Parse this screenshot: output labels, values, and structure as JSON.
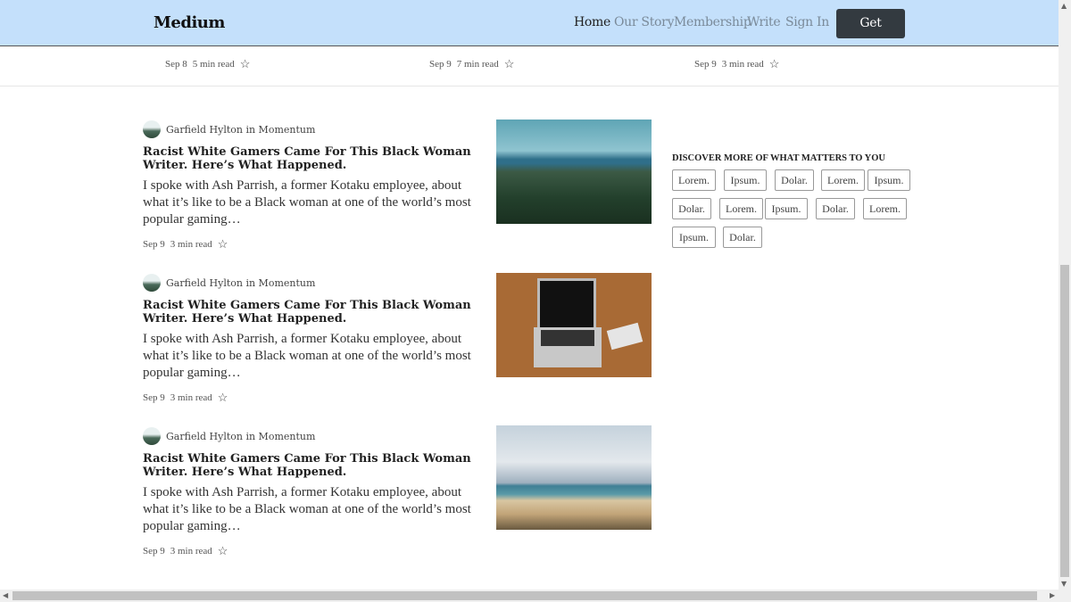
{
  "nav": {
    "logo": "Medium",
    "links": [
      "Home",
      "Our Story",
      "Membership",
      "Write",
      "Sign In"
    ],
    "cta": "Get Started"
  },
  "trending": [
    {
      "date": "Sep 8",
      "read": "5 min read"
    },
    {
      "date": "Sep 9",
      "read": "7 min read"
    },
    {
      "date": "Sep 9",
      "read": "3 min read"
    }
  ],
  "articles": [
    {
      "author": "Garfield Hylton in Momentum",
      "title": "Racist White Gamers Came For This Black Woman Writer. Here’s What Happened.",
      "excerpt": "I spoke with Ash Parrish, a former Kotaku employee, about what it’s like to be a Black woman at one of the world’s most popular gaming…",
      "date": "Sep 9",
      "read": "3 min read",
      "image": "forest"
    },
    {
      "author": "Garfield Hylton in Momentum",
      "title": "Racist White Gamers Came For This Black Woman Writer. Here’s What Happened.",
      "excerpt": "I spoke with Ash Parrish, a former Kotaku employee, about what it’s like to be a Black woman at one of the world’s most popular gaming…",
      "date": "Sep 9",
      "read": "3 min read",
      "image": "laptop"
    },
    {
      "author": "Garfield Hylton in Momentum",
      "title": "Racist White Gamers Came For This Black Woman Writer. Here’s What Happened.",
      "excerpt": "I spoke with Ash Parrish, a former Kotaku employee, about what it’s like to be a Black woman at one of the world’s most popular gaming…",
      "date": "Sep 9",
      "read": "3 min read",
      "image": "beach"
    }
  ],
  "sidebar": {
    "heading": "DISCOVER MORE OF WHAT MATTERS TO YOU",
    "tags": [
      "Lorem.",
      "Ipsum.",
      "Dolar.",
      "Lorem.",
      "Ipsum.",
      "Dolar.",
      "Lorem.",
      "Ipsum.",
      "Dolar.",
      "Lorem.",
      "Ipsum.",
      "Dolar."
    ]
  }
}
